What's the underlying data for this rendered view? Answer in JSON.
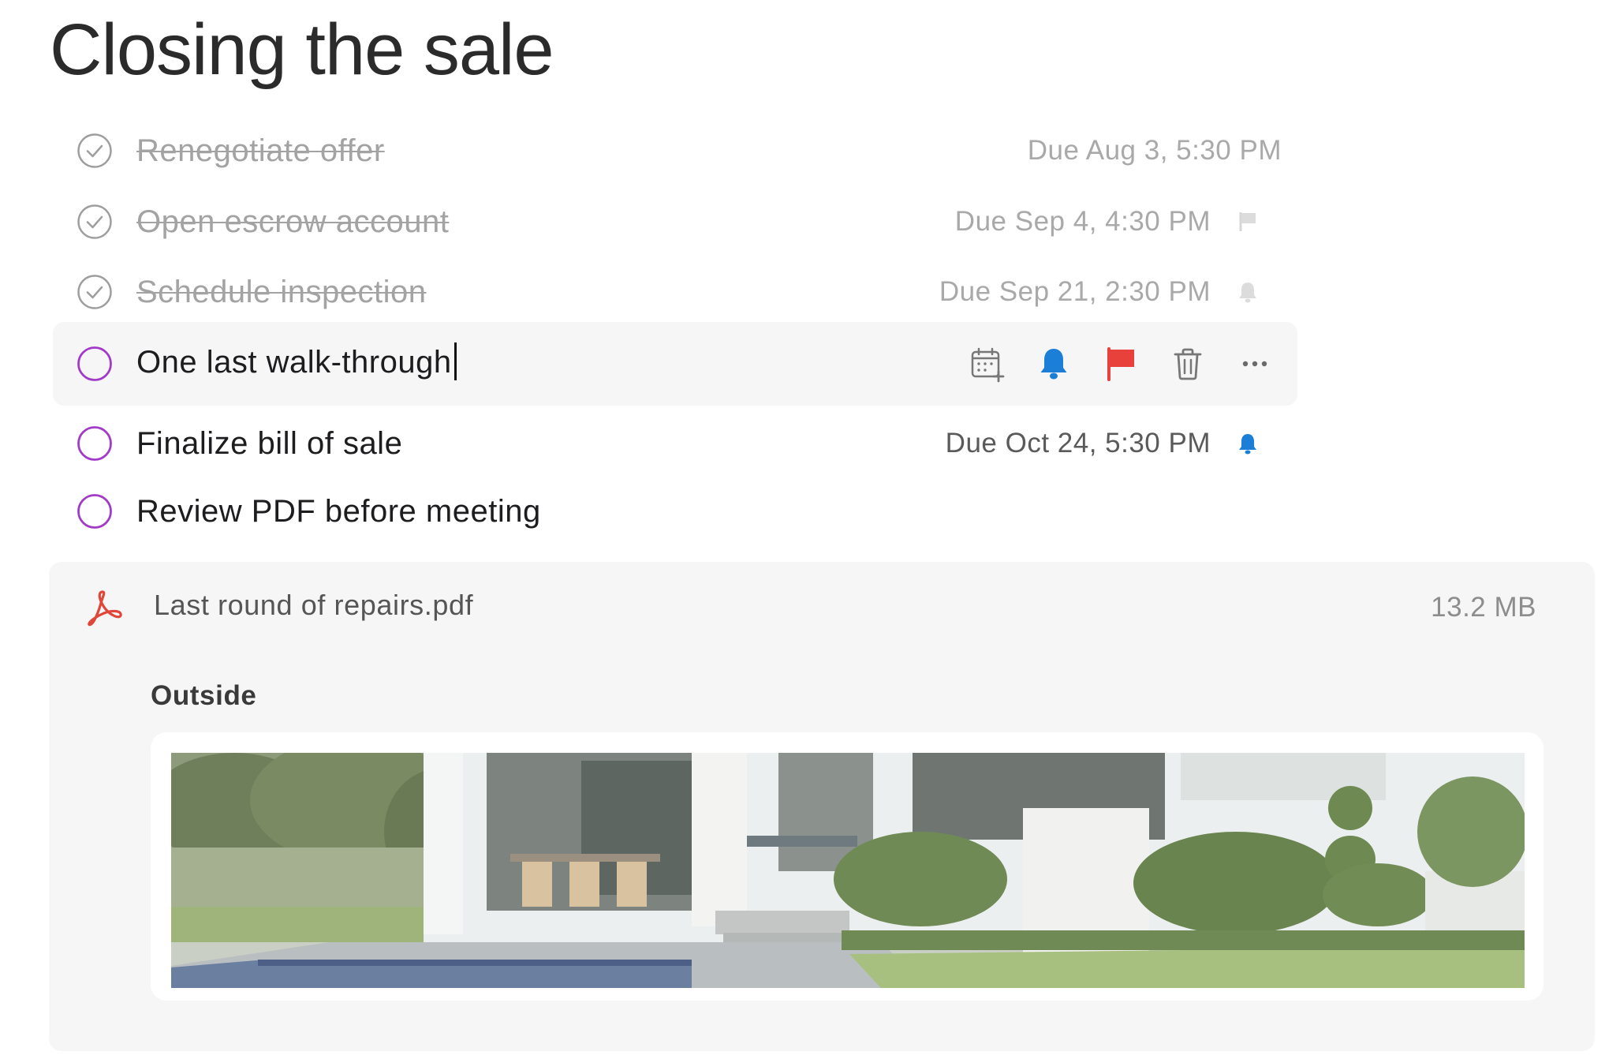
{
  "page_title": "Closing the sale",
  "tasks": [
    {
      "label": "Renegotiate offer",
      "due": "Due Aug 3, 5:30 PM",
      "completed": true,
      "indicator": "none"
    },
    {
      "label": "Open escrow account",
      "due": "Due Sep 4, 4:30 PM",
      "completed": true,
      "indicator": "flag"
    },
    {
      "label": "Schedule inspection",
      "due": "Due Sep 21, 2:30 PM",
      "completed": true,
      "indicator": "bell"
    },
    {
      "label": "One last walk-through",
      "due": "",
      "completed": false,
      "editing": true
    },
    {
      "label": "Finalize bill of sale",
      "due": "Due Oct 24, 5:30 PM",
      "completed": false,
      "indicator": "bell"
    },
    {
      "label": "Review PDF before meeting",
      "due": "",
      "completed": false,
      "indicator": "none"
    }
  ],
  "edit_toolbar": {
    "icons": [
      "calendar-add-icon",
      "bell-icon",
      "flag-icon",
      "trash-icon",
      "more-icon"
    ]
  },
  "attachment": {
    "file_name": "Last round of repairs.pdf",
    "file_size": "13.2 MB",
    "icon": "pdf-icon",
    "section_heading": "Outside"
  },
  "colors": {
    "accent_purple": "#a23cc7",
    "bell_blue": "#1b7fd8",
    "flag_red": "#e8403a",
    "pdf_red": "#e0463a",
    "completed_gray": "#a3a3a3"
  }
}
